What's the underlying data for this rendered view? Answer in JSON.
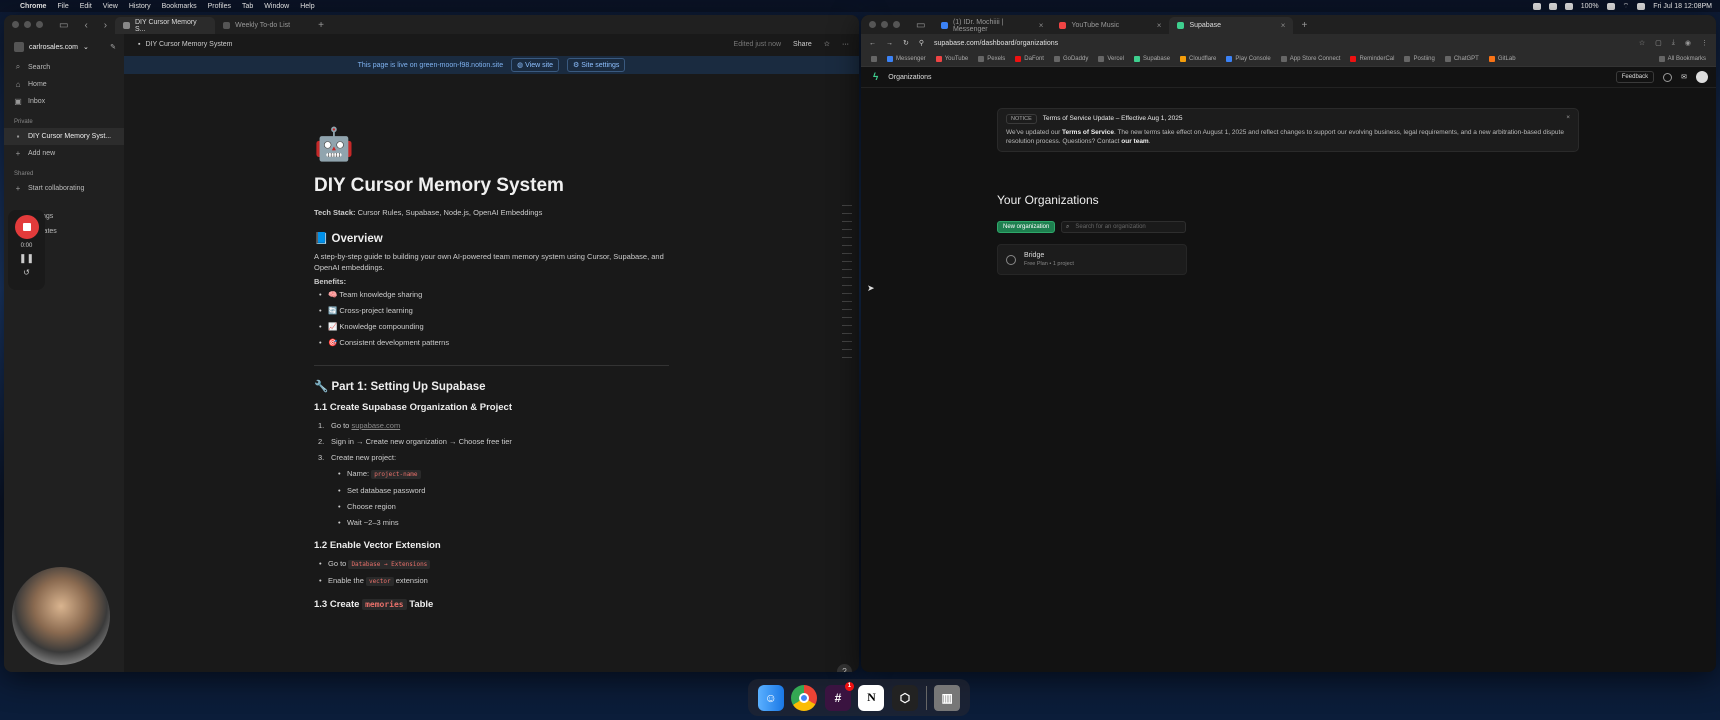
{
  "menubar": {
    "app": "Chrome",
    "items": [
      "File",
      "Edit",
      "View",
      "History",
      "Bookmarks",
      "Profiles",
      "Tab",
      "Window",
      "Help"
    ],
    "battery": "100%",
    "clock": "Fri Jul 18 12:08PM"
  },
  "notion": {
    "tabs": [
      {
        "label": "DIY Cursor Memory S...",
        "active": true
      },
      {
        "label": "Weekly To-do List",
        "active": false
      }
    ],
    "sidebar": {
      "workspace": "carlrosales.com",
      "search": "Search",
      "home": "Home",
      "inbox": "Inbox",
      "private_label": "Private",
      "page": "DIY Cursor Memory Syst...",
      "add_new": "Add new",
      "shared_label": "Shared",
      "start_collab": "Start collaborating",
      "settings_partial": "ngs",
      "templates_partial": "lates"
    },
    "topbar": {
      "breadcrumb": "DIY Cursor Memory System",
      "edited": "Edited just now",
      "share": "Share"
    },
    "banner": {
      "text": "This page is live on green-moon-f98.notion.site",
      "view_site": "View site",
      "site_settings": "Site settings"
    },
    "page": {
      "icon": "🤖",
      "title": "DIY Cursor Memory System",
      "tech_label": "Tech Stack:",
      "tech_value": " Cursor Rules, Supabase, Node.js, OpenAI Embeddings",
      "overview": "📘 Overview",
      "overview_text": "A step-by-step guide to building your own AI-powered team memory system using Cursor, Supabase, and OpenAI embeddings.",
      "benefits": "Benefits:",
      "benefit_items": [
        "🧠 Team knowledge sharing",
        "🔄 Cross-project learning",
        "📈 Knowledge compounding",
        "🎯 Consistent development patterns"
      ],
      "part1": "🔧 Part 1: Setting Up Supabase",
      "s11": "1.1 Create Supabase Organization & Project",
      "s11_go": "Go to ",
      "s11_link": "supabase.com",
      "s11_step2": "Sign in → Create new organization → Choose free tier",
      "s11_step3": "Create new project:",
      "s11_name_label": "Name: ",
      "s11_name_code": "project-name",
      "s11_sub": [
        "Set database password",
        "Choose region",
        "Wait ~2–3 mins"
      ],
      "s12": "1.2 Enable Vector Extension",
      "s12_go": "Go to ",
      "s12_code": "Database → Extensions",
      "s12_enable_a": "Enable the ",
      "s12_enable_code": "vector",
      "s12_enable_b": " extension",
      "s13_a": "1.3 Create ",
      "s13_code": "memories",
      "s13_b": " Table"
    },
    "recorder": {
      "time": "0:00"
    }
  },
  "supabase": {
    "tabs": [
      {
        "label": "(1) IDr. Mochiiii | Messenger",
        "color": "#3b82f6"
      },
      {
        "label": "YouTube Music",
        "color": "#ef4444"
      },
      {
        "label": "Supabase",
        "color": "#3ecf8e",
        "active": true
      }
    ],
    "url": "supabase.com/dashboard/organizations",
    "bookmarks": [
      "Messenger",
      "YouTube",
      "Pexels",
      "DaFont",
      "GoDaddy",
      "Vercel",
      "Supabase",
      "Cloudflare",
      "Play Console",
      "App Store Connect",
      "ReminderCal",
      "Postiing",
      "ChatGPT",
      "GitLab"
    ],
    "all_bookmarks": "All Bookmarks",
    "header": {
      "title": "Organizations",
      "feedback": "Feedback"
    },
    "notice": {
      "tag": "NOTICE",
      "title": "Terms of Service Update – Effective Aug 1, 2025",
      "body_a": "We've updated our ",
      "body_link": "Terms of Service",
      "body_b": ". The new terms take effect on August 1, 2025 and reflect changes to support our evolving business, legal requirements, and a new arbitration-based dispute resolution process. Questions? Contact ",
      "body_link2": "our team",
      "body_c": "."
    },
    "orgs_title": "Your Organizations",
    "new_org": "New organization",
    "search_placeholder": "Search for an organization",
    "org": {
      "name": "Bridge",
      "plan": "Free Plan",
      "projects": "1 project"
    }
  },
  "dock": {
    "items": [
      "Finder",
      "Chrome",
      "Slack",
      "Notion",
      "Cursor",
      "Trash"
    ],
    "slack_badge": "1"
  }
}
